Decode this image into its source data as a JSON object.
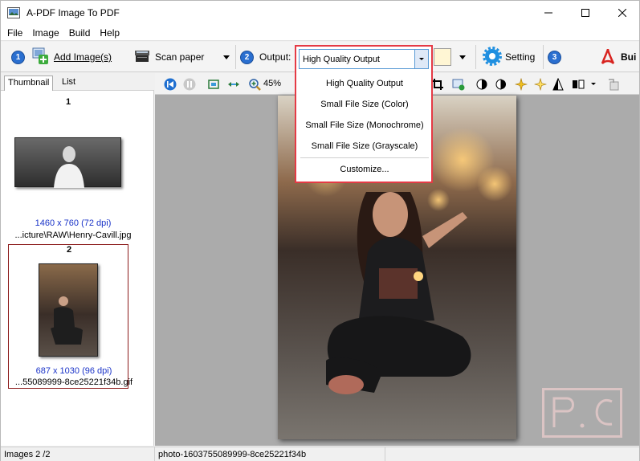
{
  "window": {
    "title": "A-PDF Image To PDF"
  },
  "menu": [
    "File",
    "Image",
    "Build",
    "Help"
  ],
  "toolbar": {
    "step1": "1",
    "add_images": "Add Image(s)",
    "scan_paper": "Scan paper",
    "step2": "2",
    "output_label": "Output:",
    "output_value": "High Quality Output",
    "setting": "Setting",
    "step3": "3",
    "build": "Bui"
  },
  "dropdown": {
    "selected": "High Quality Output",
    "options": [
      "High Quality Output",
      "Small File Size (Color)",
      "Small File Size (Monochrome)",
      "Small File Size (Grayscale)",
      "Customize..."
    ]
  },
  "tabs": [
    "Thumbnail",
    "List"
  ],
  "thumbnails": [
    {
      "num": "1",
      "info": "1460 x 760 (72 dpi)",
      "file": "...icture\\RAW\\Henry-Cavill.jpg"
    },
    {
      "num": "2",
      "info": "687 x 1030 (96 dpi)",
      "file": "...55089999-8ce25221f34b.gif"
    }
  ],
  "viewer": {
    "zoom": "45%"
  },
  "status": {
    "images": "Images 2 /2",
    "file": "photo-1603755089999-8ce25221f34b"
  },
  "colors": {
    "accent_blue": "#2a6fd0",
    "highlight_red": "#e53a45",
    "info_blue": "#1a33c8"
  }
}
